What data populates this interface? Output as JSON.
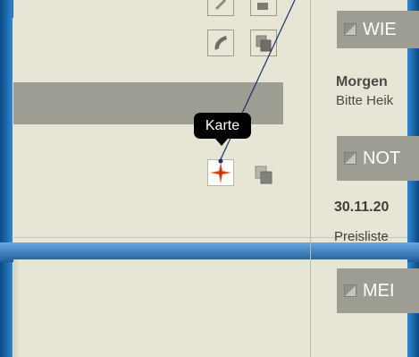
{
  "tooltip": {
    "label": "Karte"
  },
  "sections": [
    {
      "title": "WIE"
    },
    {
      "title": "NOT"
    },
    {
      "title": "MEI"
    }
  ],
  "news": {
    "title": "Morgen",
    "subtitle": "Bitte Heik"
  },
  "notices": {
    "date": "30.11.20",
    "text": "Preisliste"
  },
  "icons": {
    "edit": "pencil-icon",
    "phone": "phone-icon",
    "copy": "copy-icon",
    "map": "compass-star-icon"
  },
  "colors": {
    "frame_blue": "#1a6eb0",
    "panel_bg": "#e7e6d6",
    "header_gray": "#9d9d93",
    "map_icon_orange": "#ee5a24",
    "callout_line": "#1b2f6b"
  }
}
